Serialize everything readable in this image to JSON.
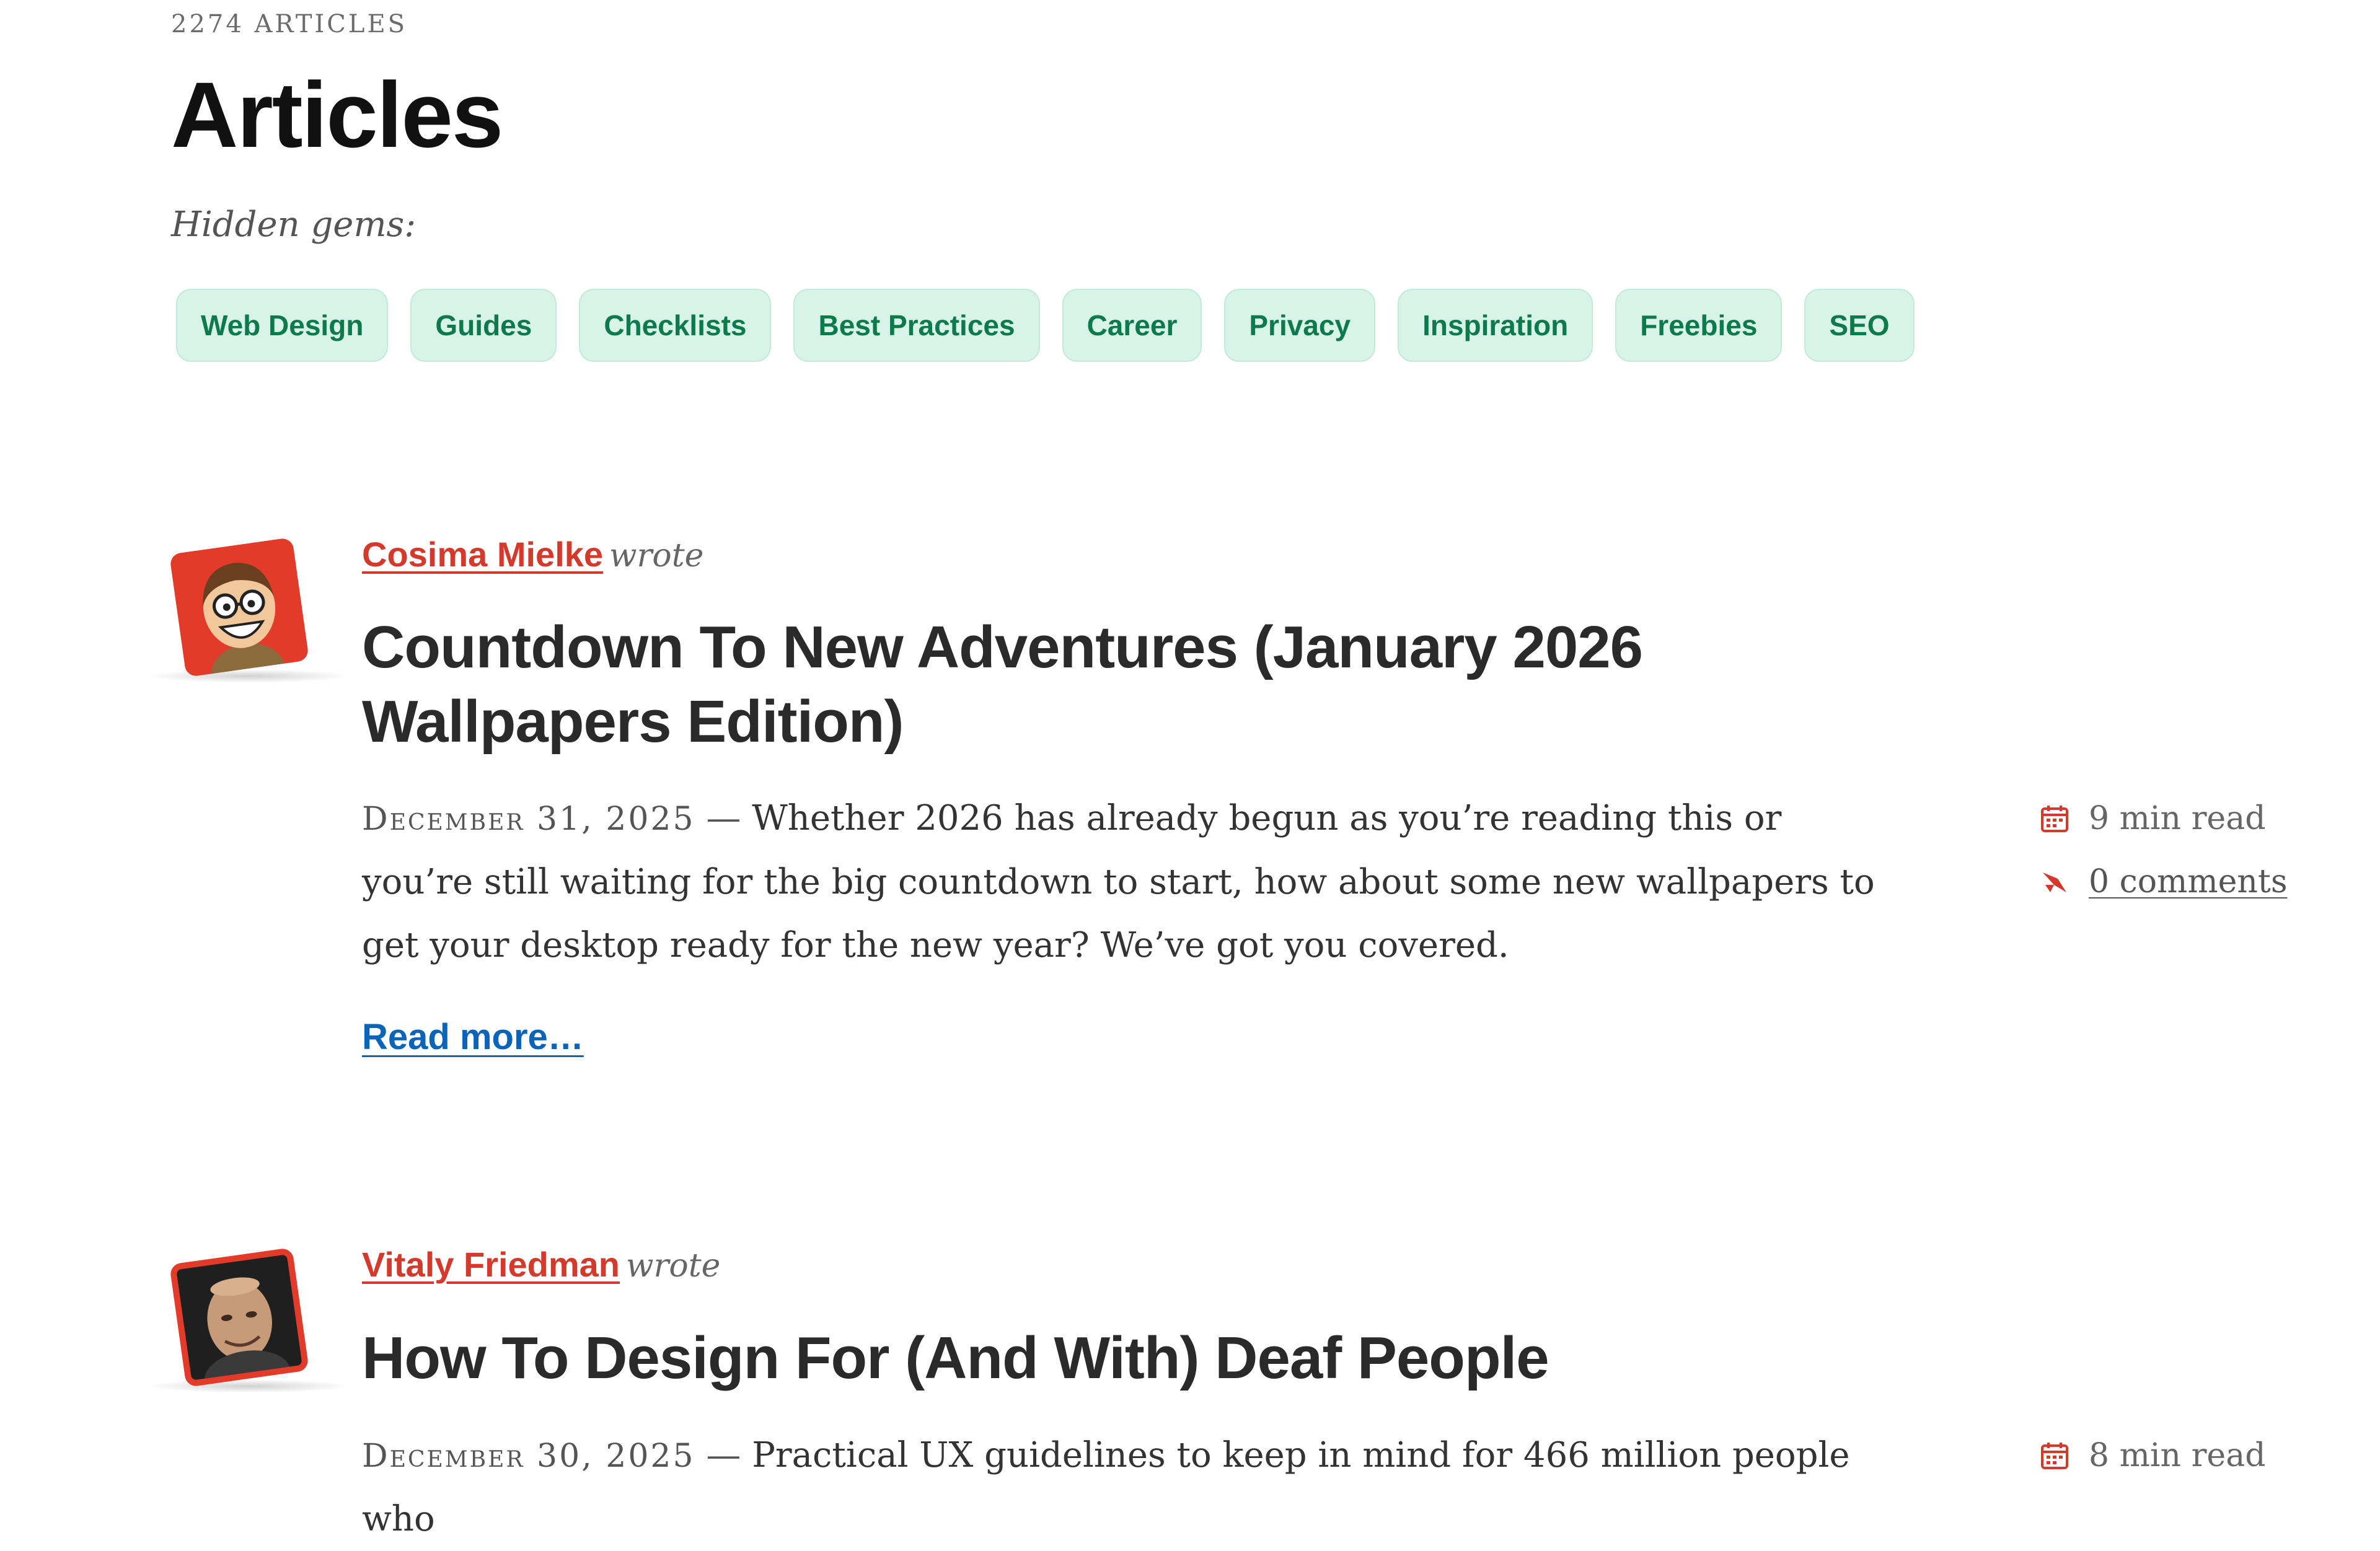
{
  "header": {
    "count": "2274 ARTICLES",
    "title": "Articles",
    "hidden_gems": "Hidden gems:"
  },
  "chips": [
    "Web Design",
    "Guides",
    "Checklists",
    "Best Practices",
    "Career",
    "Privacy",
    "Inspiration",
    "Freebies",
    "SEO"
  ],
  "articles": [
    {
      "author": "Cosima Mielke",
      "wrote": "wrote",
      "title": "Countdown To New Adventures (January 2026 Wallpapers Edition)",
      "date": "December 31, 2025",
      "dash": "—",
      "excerpt": "Whether 2026 has already begun as you’re reading this or you’re still waiting for the big countdown to start, how about some new wallpapers to get your desktop ready for the new year? We’ve got you covered.",
      "read_more": "Read more…",
      "read_time": "9 min read",
      "comments": "0 comments",
      "avatar_icon": "cartoon-portrait-avatar"
    },
    {
      "author": "Vitaly Friedman",
      "wrote": "wrote",
      "title": "How To Design For (And With) Deaf People",
      "date": "December 30, 2025",
      "dash": "—",
      "excerpt": "Practical UX guidelines to keep in mind for 466 million people who",
      "read_time": "8 min read",
      "avatar_icon": "photo-portrait-avatar"
    }
  ],
  "colors": {
    "accent_red": "#d33a2c",
    "chip_bg": "#d8f3e8",
    "chip_text": "#0d7a4b",
    "link_blue": "#0b64b8"
  },
  "icons": {
    "calendar": "calendar-icon",
    "comment": "comment-icon"
  }
}
